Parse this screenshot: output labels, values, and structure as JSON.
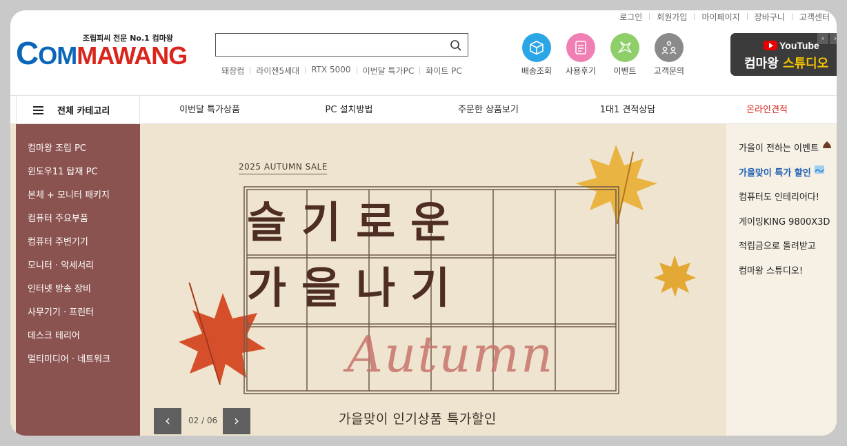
{
  "util_links": [
    "로그인",
    "회원가입",
    "마이페이지",
    "장바구니",
    "고객센터"
  ],
  "logo": {
    "tagline": "조립피씨 전문 No.1 컴마왕",
    "c": "C",
    "om": "OM",
    "mawang": "MAWANG"
  },
  "search": {
    "placeholder": ""
  },
  "keywords": [
    "돼장컴",
    "라이젠5세대",
    "RTX 5000",
    "이번달 특가PC",
    "화이트 PC"
  ],
  "quick_links": [
    {
      "label": "배송조회",
      "icon": "box-icon",
      "color": "#2aa6e6"
    },
    {
      "label": "사용후기",
      "icon": "review-icon",
      "color": "#f07fb3"
    },
    {
      "label": "이벤트",
      "icon": "bird-icon",
      "color": "#8fcf6a"
    },
    {
      "label": "고객문의",
      "icon": "people-icon",
      "color": "#8a8a8a"
    }
  ],
  "youtube": {
    "brand": "YouTube",
    "studio_a": "컴마왕",
    "studio_b": "스튜디오"
  },
  "nav": {
    "all_category": "전체 카테고리",
    "menu": [
      "이번달 특가상품",
      "PC 설치방법",
      "주문한 상품보기",
      "1대1 견적상담",
      "온라인견적"
    ]
  },
  "categories": [
    "컴마왕 조립 PC",
    "윈도우11 탑재 PC",
    "본체 + 모니터 패키지",
    "컴퓨터 주요부품",
    "컴퓨터 주변기기",
    "모니터 · 악세서리",
    "인터넷 방송 장비",
    "사무기기 · 프린터",
    "데스크 테리어",
    "멀티미디어 · 네트워크"
  ],
  "side_events": [
    "가을이 전하는 이벤트",
    "가을맞이 특가 할인",
    "컴퓨터도 인테리어다!",
    "게이밍KING 9800X3D",
    "적립금으로 돌려받고",
    "컴마왕 스튜디오!"
  ],
  "banner": {
    "sale_prefix": "202",
    "sale_suffix": "5 AUTUMN SALE",
    "title_line1": "슬기로운",
    "title_line2": "가을나기",
    "script": "Autumn",
    "subtitle": "가을맞이 인기상품 특가할인",
    "page_current": "02",
    "page_total": "06"
  },
  "colors": {
    "accent_red": "#d9261c",
    "accent_blue": "#1d5fb4",
    "category_bg": "#8b5350"
  }
}
